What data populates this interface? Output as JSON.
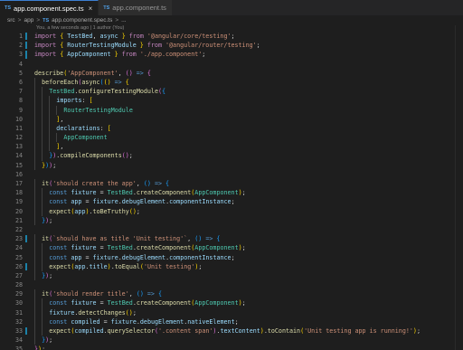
{
  "tabs": [
    {
      "badge": "TS",
      "name": "app.component.spec.ts",
      "close": "×",
      "active": true
    },
    {
      "badge": "TS",
      "name": "app.component.ts",
      "active": false
    }
  ],
  "breadcrumb": {
    "folder": "src",
    "sep": ">",
    "folder2": "app",
    "file_badge": "TS",
    "file": "app.component.spec.ts",
    "ellipsis": "..."
  },
  "blame": "You, a few seconds ago | 1 author (You)",
  "colors": {
    "accent": "#3c7fd1",
    "modified_marker": "#1b81a8",
    "background": "#1e1e1e"
  },
  "lines": [
    {
      "n": "1",
      "mod": true,
      "ind": 0,
      "t": [
        [
          "kc",
          "import"
        ],
        [
          "p",
          " "
        ],
        [
          "br",
          "{"
        ],
        [
          "p",
          " "
        ],
        [
          "var",
          "TestBed"
        ],
        [
          "p",
          ", "
        ],
        [
          "var",
          "async"
        ],
        [
          "p",
          " "
        ],
        [
          "br",
          "}"
        ],
        [
          "p",
          " "
        ],
        [
          "kc",
          "from"
        ],
        [
          "p",
          " "
        ],
        [
          "str",
          "'@angular/core/testing'"
        ],
        [
          "p",
          ";"
        ]
      ]
    },
    {
      "n": "2",
      "mod": true,
      "ind": 0,
      "t": [
        [
          "kc",
          "import"
        ],
        [
          "p",
          " "
        ],
        [
          "br",
          "{"
        ],
        [
          "p",
          " "
        ],
        [
          "var",
          "RouterTestingModule"
        ],
        [
          "p",
          " "
        ],
        [
          "br",
          "}"
        ],
        [
          "p",
          " "
        ],
        [
          "kc",
          "from"
        ],
        [
          "p",
          " "
        ],
        [
          "str",
          "'@angular/router/testing'"
        ],
        [
          "p",
          ";"
        ]
      ]
    },
    {
      "n": "3",
      "mod": true,
      "ind": 0,
      "t": [
        [
          "kc",
          "import"
        ],
        [
          "p",
          " "
        ],
        [
          "br",
          "{"
        ],
        [
          "p",
          " "
        ],
        [
          "var",
          "AppComponent"
        ],
        [
          "p",
          " "
        ],
        [
          "br",
          "}"
        ],
        [
          "p",
          " "
        ],
        [
          "kc",
          "from"
        ],
        [
          "p",
          " "
        ],
        [
          "str",
          "'./app.component'"
        ],
        [
          "p",
          ";"
        ]
      ]
    },
    {
      "n": "4",
      "mod": false,
      "ind": 0,
      "t": []
    },
    {
      "n": "5",
      "mod": false,
      "ind": 0,
      "t": [
        [
          "fn",
          "describe"
        ],
        [
          "br",
          "("
        ],
        [
          "str",
          "'AppComponent'"
        ],
        [
          "p",
          ", "
        ],
        [
          "br2",
          "("
        ],
        [
          "br2",
          ")"
        ],
        [
          "p",
          " "
        ],
        [
          "kw",
          "=>"
        ],
        [
          "p",
          " "
        ],
        [
          "br2",
          "{"
        ]
      ]
    },
    {
      "n": "6",
      "mod": false,
      "ind": 1,
      "t": [
        [
          "fn",
          "beforeEach"
        ],
        [
          "br2",
          "("
        ],
        [
          "fn",
          "async"
        ],
        [
          "br3",
          "("
        ],
        [
          "br",
          "("
        ],
        [
          "br",
          ")"
        ],
        [
          "p",
          " "
        ],
        [
          "kw",
          "=>"
        ],
        [
          "p",
          " "
        ],
        [
          "br",
          "{"
        ]
      ]
    },
    {
      "n": "7",
      "mod": false,
      "ind": 2,
      "t": [
        [
          "cls",
          "TestBed"
        ],
        [
          "p",
          "."
        ],
        [
          "fn",
          "configureTestingModule"
        ],
        [
          "br2",
          "("
        ],
        [
          "br3",
          "{"
        ]
      ]
    },
    {
      "n": "8",
      "mod": false,
      "ind": 3,
      "t": [
        [
          "var",
          "imports"
        ],
        [
          "p",
          ": "
        ],
        [
          "br",
          "["
        ]
      ]
    },
    {
      "n": "9",
      "mod": false,
      "ind": 4,
      "t": [
        [
          "cls",
          "RouterTestingModule"
        ]
      ]
    },
    {
      "n": "10",
      "mod": false,
      "ind": 3,
      "t": [
        [
          "br",
          "]"
        ],
        [
          "p",
          ","
        ]
      ]
    },
    {
      "n": "11",
      "mod": false,
      "ind": 3,
      "t": [
        [
          "var",
          "declarations"
        ],
        [
          "p",
          ": "
        ],
        [
          "br",
          "["
        ]
      ]
    },
    {
      "n": "12",
      "mod": false,
      "ind": 4,
      "t": [
        [
          "cls",
          "AppComponent"
        ]
      ]
    },
    {
      "n": "13",
      "mod": false,
      "ind": 3,
      "t": [
        [
          "br",
          "]"
        ],
        [
          "p",
          ","
        ]
      ]
    },
    {
      "n": "14",
      "mod": false,
      "ind": 2,
      "t": [
        [
          "br3",
          "}"
        ],
        [
          "br2",
          ")"
        ],
        [
          "p",
          "."
        ],
        [
          "fn",
          "compileComponents"
        ],
        [
          "br2",
          "("
        ],
        [
          "br2",
          ")"
        ],
        [
          "p",
          ";"
        ]
      ]
    },
    {
      "n": "15",
      "mod": false,
      "ind": 1,
      "t": [
        [
          "br",
          "}"
        ],
        [
          "br3",
          ")"
        ],
        [
          "br2",
          ")"
        ],
        [
          "p",
          ";"
        ]
      ]
    },
    {
      "n": "16",
      "mod": false,
      "ind": 0,
      "t": []
    },
    {
      "n": "17",
      "mod": false,
      "ind": 1,
      "t": [
        [
          "fn",
          "it"
        ],
        [
          "br2",
          "("
        ],
        [
          "str",
          "'should create the app'"
        ],
        [
          "p",
          ", "
        ],
        [
          "br3",
          "("
        ],
        [
          "br3",
          ")"
        ],
        [
          "p",
          " "
        ],
        [
          "kw",
          "=>"
        ],
        [
          "p",
          " "
        ],
        [
          "br3",
          "{"
        ]
      ]
    },
    {
      "n": "18",
      "mod": false,
      "ind": 2,
      "t": [
        [
          "kw",
          "const"
        ],
        [
          "p",
          " "
        ],
        [
          "var",
          "fixture"
        ],
        [
          "p",
          " = "
        ],
        [
          "cls",
          "TestBed"
        ],
        [
          "p",
          "."
        ],
        [
          "fn",
          "createComponent"
        ],
        [
          "br",
          "("
        ],
        [
          "cls",
          "AppComponent"
        ],
        [
          "br",
          ")"
        ],
        [
          "p",
          ";"
        ]
      ]
    },
    {
      "n": "19",
      "mod": false,
      "ind": 2,
      "t": [
        [
          "kw",
          "const"
        ],
        [
          "p",
          " "
        ],
        [
          "var",
          "app"
        ],
        [
          "p",
          " = "
        ],
        [
          "var",
          "fixture"
        ],
        [
          "p",
          "."
        ],
        [
          "var",
          "debugElement"
        ],
        [
          "p",
          "."
        ],
        [
          "var",
          "componentInstance"
        ],
        [
          "p",
          ";"
        ]
      ]
    },
    {
      "n": "20",
      "mod": false,
      "ind": 2,
      "t": [
        [
          "fn",
          "expect"
        ],
        [
          "br",
          "("
        ],
        [
          "var",
          "app"
        ],
        [
          "br",
          ")"
        ],
        [
          "p",
          "."
        ],
        [
          "fn",
          "toBeTruthy"
        ],
        [
          "br",
          "("
        ],
        [
          "br",
          ")"
        ],
        [
          "p",
          ";"
        ]
      ]
    },
    {
      "n": "21",
      "mod": false,
      "ind": 1,
      "t": [
        [
          "br3",
          "}"
        ],
        [
          "br2",
          ")"
        ],
        [
          "p",
          ";"
        ]
      ]
    },
    {
      "n": "22",
      "mod": false,
      "ind": 0,
      "t": []
    },
    {
      "n": "23",
      "mod": true,
      "ind": 1,
      "t": [
        [
          "fn",
          "it"
        ],
        [
          "br2",
          "("
        ],
        [
          "str",
          "`should have as title 'Unit testing'`"
        ],
        [
          "p",
          ", "
        ],
        [
          "br3",
          "("
        ],
        [
          "br3",
          ")"
        ],
        [
          "p",
          " "
        ],
        [
          "kw",
          "=>"
        ],
        [
          "p",
          " "
        ],
        [
          "br3",
          "{"
        ]
      ]
    },
    {
      "n": "24",
      "mod": false,
      "ind": 2,
      "t": [
        [
          "kw",
          "const"
        ],
        [
          "p",
          " "
        ],
        [
          "var",
          "fixture"
        ],
        [
          "p",
          " = "
        ],
        [
          "cls",
          "TestBed"
        ],
        [
          "p",
          "."
        ],
        [
          "fn",
          "createComponent"
        ],
        [
          "br",
          "("
        ],
        [
          "cls",
          "AppComponent"
        ],
        [
          "br",
          ")"
        ],
        [
          "p",
          ";"
        ]
      ]
    },
    {
      "n": "25",
      "mod": false,
      "ind": 2,
      "t": [
        [
          "kw",
          "const"
        ],
        [
          "p",
          " "
        ],
        [
          "var",
          "app"
        ],
        [
          "p",
          " = "
        ],
        [
          "var",
          "fixture"
        ],
        [
          "p",
          "."
        ],
        [
          "var",
          "debugElement"
        ],
        [
          "p",
          "."
        ],
        [
          "var",
          "componentInstance"
        ],
        [
          "p",
          ";"
        ]
      ]
    },
    {
      "n": "26",
      "mod": true,
      "ind": 2,
      "t": [
        [
          "fn",
          "expect"
        ],
        [
          "br",
          "("
        ],
        [
          "var",
          "app"
        ],
        [
          "p",
          "."
        ],
        [
          "var",
          "title"
        ],
        [
          "br",
          ")"
        ],
        [
          "p",
          "."
        ],
        [
          "fn",
          "toEqual"
        ],
        [
          "br",
          "("
        ],
        [
          "str",
          "'Unit testing'"
        ],
        [
          "br",
          ")"
        ],
        [
          "p",
          ";"
        ]
      ]
    },
    {
      "n": "27",
      "mod": false,
      "ind": 1,
      "t": [
        [
          "br3",
          "}"
        ],
        [
          "br2",
          ")"
        ],
        [
          "p",
          ";"
        ]
      ]
    },
    {
      "n": "28",
      "mod": false,
      "ind": 0,
      "t": []
    },
    {
      "n": "29",
      "mod": false,
      "ind": 1,
      "t": [
        [
          "fn",
          "it"
        ],
        [
          "br2",
          "("
        ],
        [
          "str",
          "'should render title'"
        ],
        [
          "p",
          ", "
        ],
        [
          "br3",
          "("
        ],
        [
          "br3",
          ")"
        ],
        [
          "p",
          " "
        ],
        [
          "kw",
          "=>"
        ],
        [
          "p",
          " "
        ],
        [
          "br3",
          "{"
        ]
      ]
    },
    {
      "n": "30",
      "mod": false,
      "ind": 2,
      "t": [
        [
          "kw",
          "const"
        ],
        [
          "p",
          " "
        ],
        [
          "var",
          "fixture"
        ],
        [
          "p",
          " = "
        ],
        [
          "cls",
          "TestBed"
        ],
        [
          "p",
          "."
        ],
        [
          "fn",
          "createComponent"
        ],
        [
          "br",
          "("
        ],
        [
          "cls",
          "AppComponent"
        ],
        [
          "br",
          ")"
        ],
        [
          "p",
          ";"
        ]
      ]
    },
    {
      "n": "31",
      "mod": false,
      "ind": 2,
      "t": [
        [
          "var",
          "fixture"
        ],
        [
          "p",
          "."
        ],
        [
          "fn",
          "detectChanges"
        ],
        [
          "br",
          "("
        ],
        [
          "br",
          ")"
        ],
        [
          "p",
          ";"
        ]
      ]
    },
    {
      "n": "32",
      "mod": false,
      "ind": 2,
      "t": [
        [
          "kw",
          "const"
        ],
        [
          "p",
          " "
        ],
        [
          "var",
          "compiled"
        ],
        [
          "p",
          " = "
        ],
        [
          "var",
          "fixture"
        ],
        [
          "p",
          "."
        ],
        [
          "var",
          "debugElement"
        ],
        [
          "p",
          "."
        ],
        [
          "var",
          "nativeElement"
        ],
        [
          "p",
          ";"
        ]
      ]
    },
    {
      "n": "33",
      "mod": true,
      "ind": 2,
      "t": [
        [
          "fn",
          "expect"
        ],
        [
          "br",
          "("
        ],
        [
          "var",
          "compiled"
        ],
        [
          "p",
          "."
        ],
        [
          "fn",
          "querySelector"
        ],
        [
          "br2",
          "("
        ],
        [
          "str",
          "'.content span'"
        ],
        [
          "br2",
          ")"
        ],
        [
          "p",
          "."
        ],
        [
          "var",
          "textContent"
        ],
        [
          "br",
          ")"
        ],
        [
          "p",
          "."
        ],
        [
          "fn",
          "toContain"
        ],
        [
          "br",
          "("
        ],
        [
          "str",
          "'Unit testing app is running!'"
        ],
        [
          "br",
          ")"
        ],
        [
          "p",
          ";"
        ]
      ]
    },
    {
      "n": "34",
      "mod": false,
      "ind": 1,
      "t": [
        [
          "br3",
          "}"
        ],
        [
          "br2",
          ")"
        ],
        [
          "p",
          ";"
        ]
      ]
    },
    {
      "n": "35",
      "mod": false,
      "ind": 0,
      "t": [
        [
          "br2",
          "}"
        ],
        [
          "br",
          ")"
        ],
        [
          "p",
          ";"
        ]
      ]
    },
    {
      "n": "36",
      "mod": false,
      "ind": 0,
      "t": [],
      "cursor": true
    }
  ]
}
